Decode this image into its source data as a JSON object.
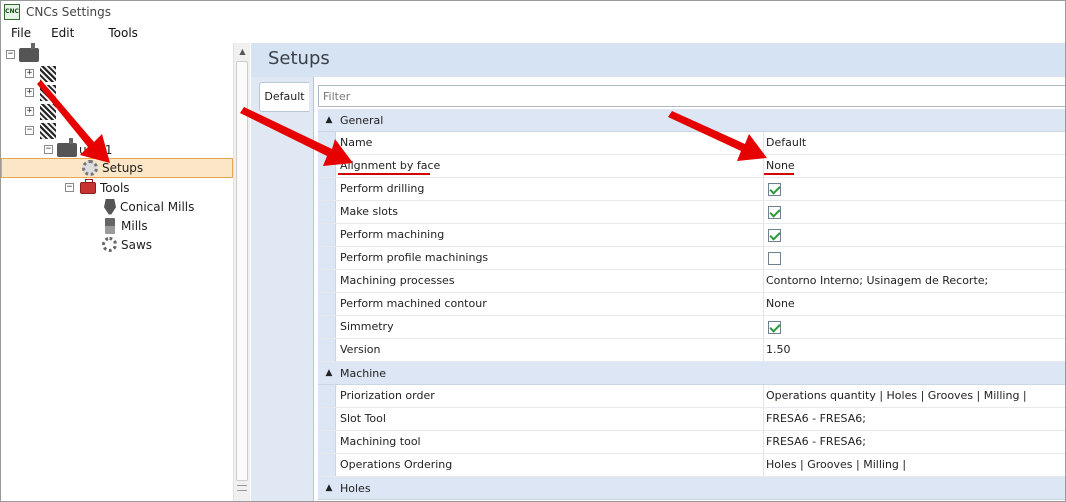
{
  "window": {
    "title": "CNCs Settings",
    "app_icon_text": "CNC"
  },
  "menu": [
    "File",
    "Edit",
    "Tools"
  ],
  "tree": {
    "machine_label": "uina1",
    "setups_label": "Setups",
    "tools_label": "Tools",
    "tool_items": [
      "Conical Mills",
      "Mills",
      "Saws"
    ]
  },
  "panel": {
    "title": "Setups",
    "tab_label": "Default",
    "filter_placeholder": "Filter"
  },
  "grid": {
    "categories": [
      {
        "label": "General",
        "rows": [
          {
            "name": "Name",
            "value": "Default"
          },
          {
            "name": "Alignment by face",
            "value": "None"
          },
          {
            "name": "Perform drilling",
            "checked": true
          },
          {
            "name": "Make slots",
            "checked": true
          },
          {
            "name": "Perform machining",
            "checked": true
          },
          {
            "name": "Perform profile machinings",
            "checked": false
          },
          {
            "name": "Machining processes",
            "value": "Contorno Interno; Usinagem de Recorte;"
          },
          {
            "name": "Perform machined contour",
            "value": "None"
          },
          {
            "name": "Simmetry",
            "checked": true
          },
          {
            "name": "Version",
            "value": "1.50"
          }
        ]
      },
      {
        "label": "Machine",
        "rows": [
          {
            "name": "Priorization order",
            "value": "Operations quantity | Holes | Grooves | Milling |"
          },
          {
            "name": "Slot Tool",
            "value": "FRESA6 - FRESA6;"
          },
          {
            "name": "Machining tool",
            "value": "FRESA6 - FRESA6;"
          },
          {
            "name": "Operations Ordering",
            "value": "Holes | Grooves | Milling |"
          }
        ]
      },
      {
        "label": "Holes",
        "rows": []
      }
    ]
  },
  "colors": {
    "arrow_red": "#e60000",
    "selection_bg": "#fbe6c8",
    "header_blue": "#d6e3f3"
  }
}
